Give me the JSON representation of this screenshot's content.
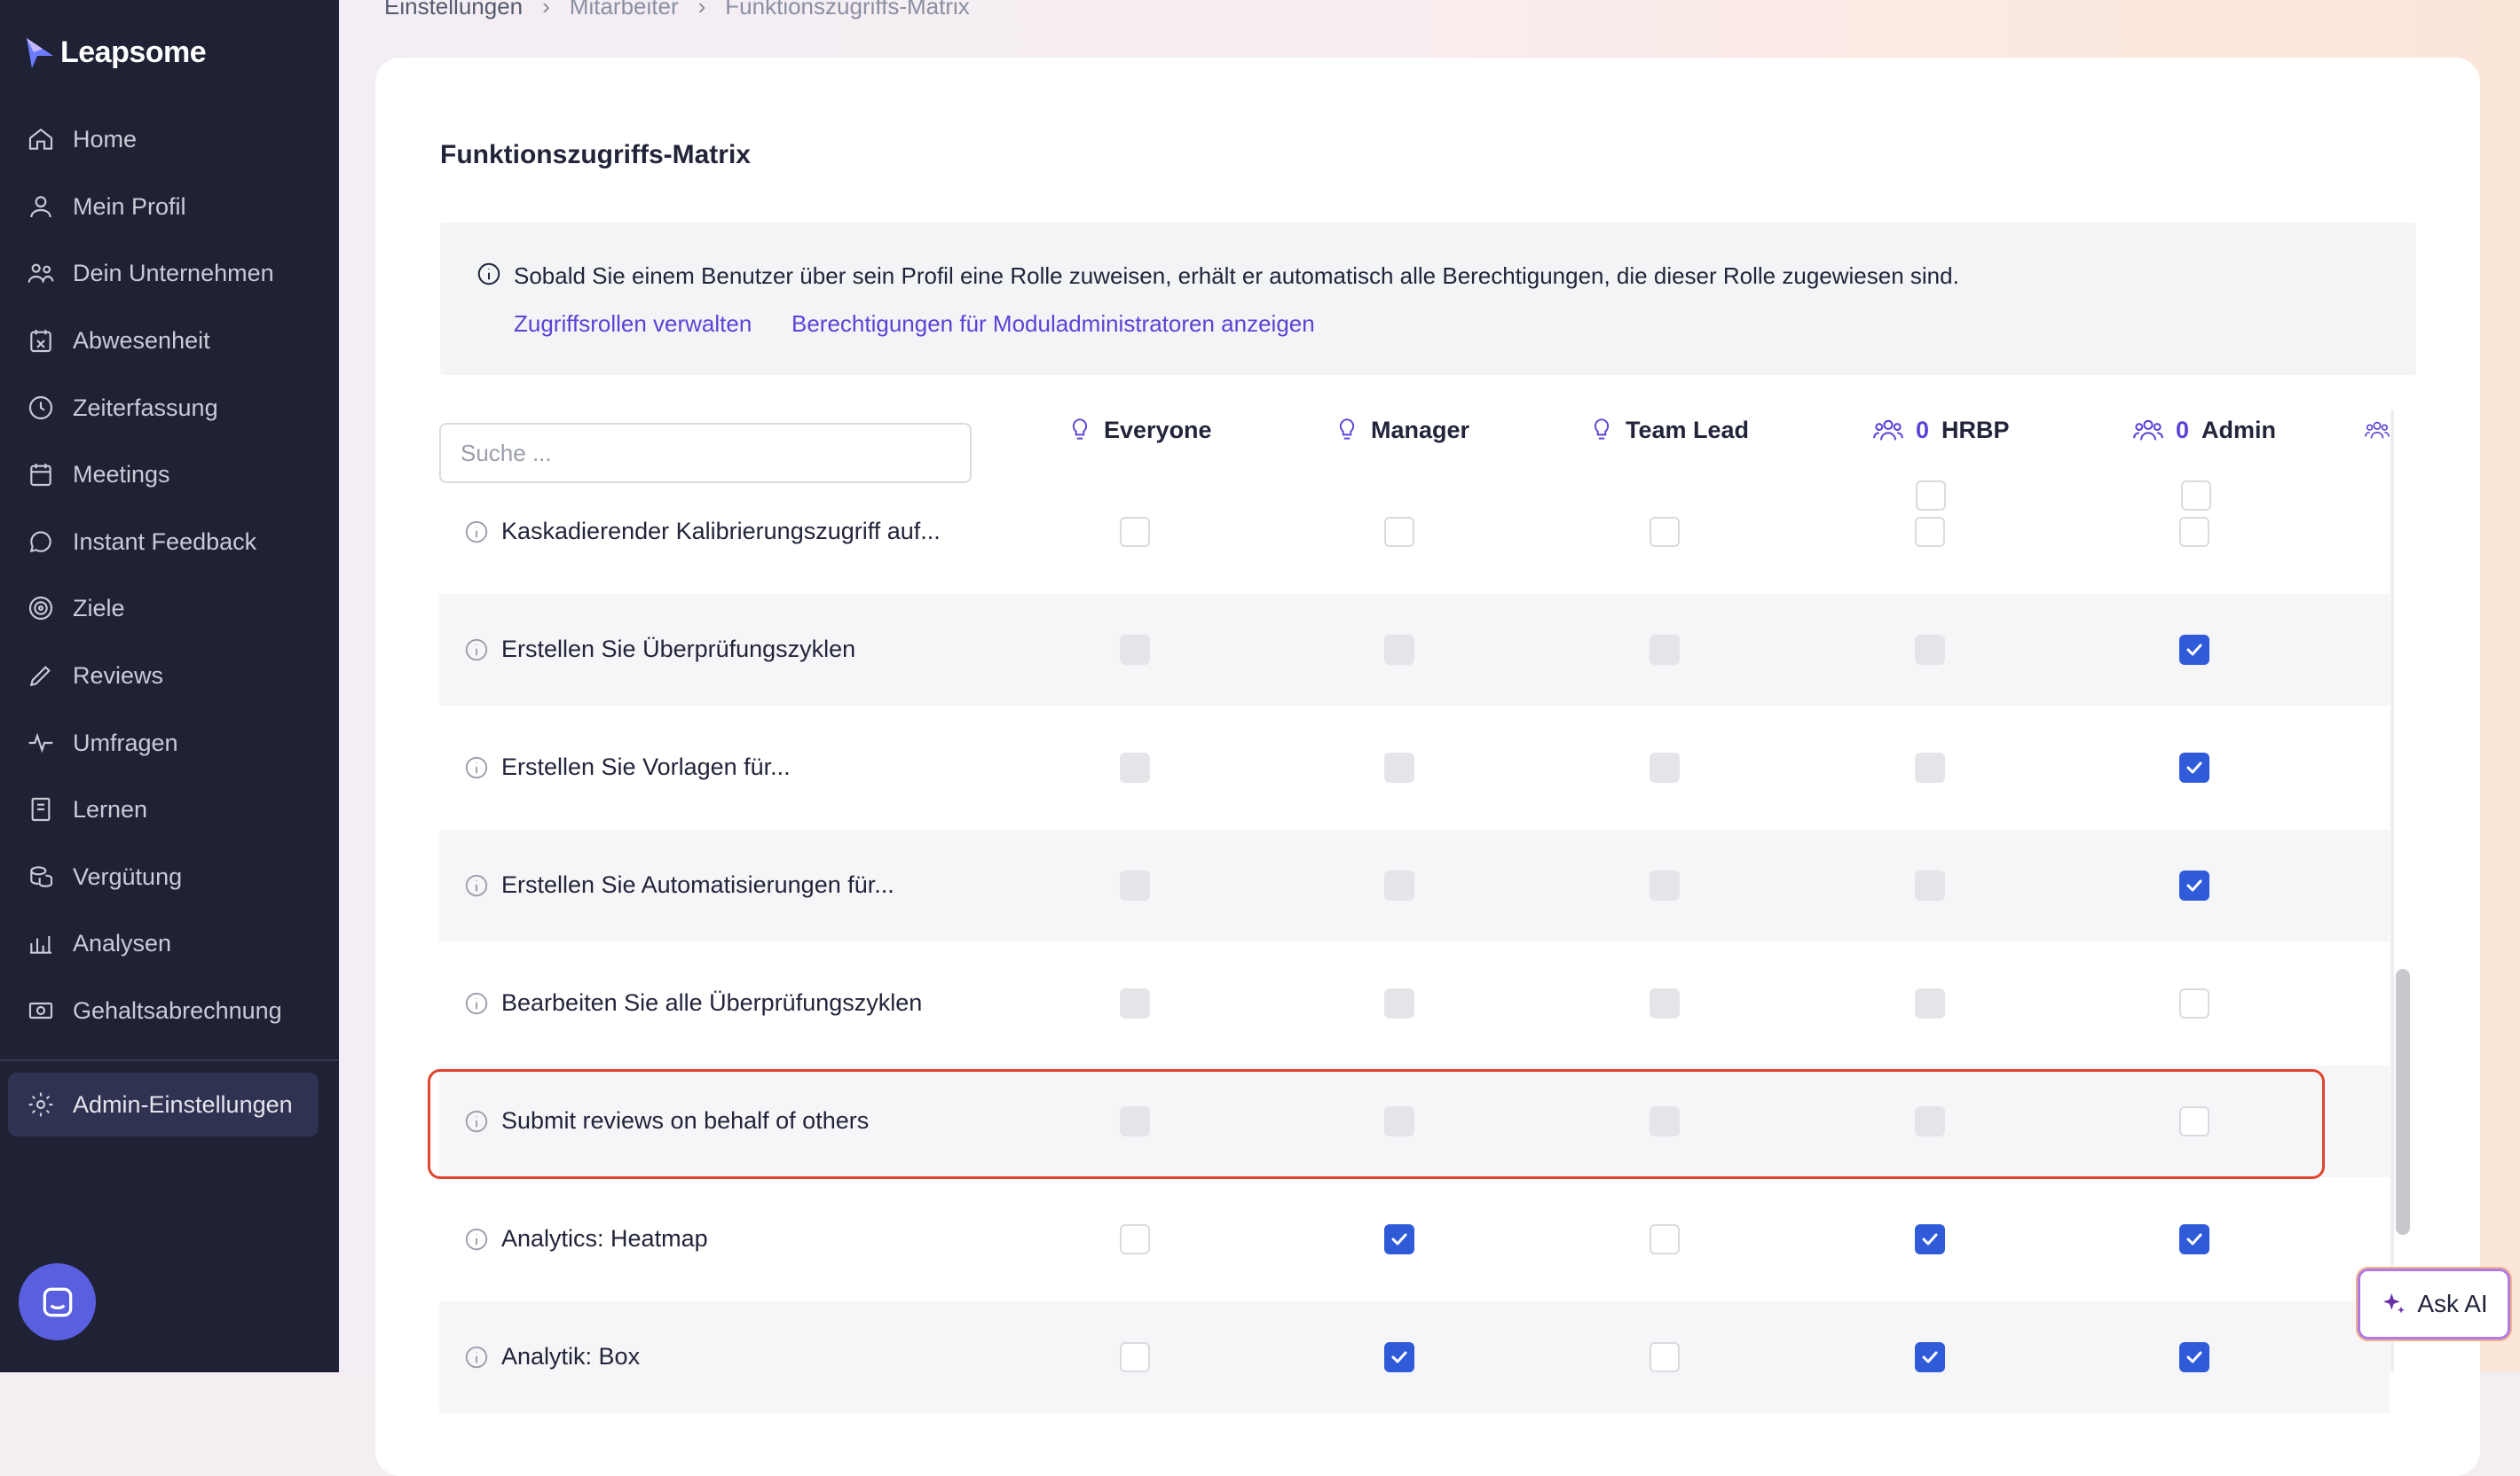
{
  "app": {
    "brand": "Leapsome"
  },
  "sidebar": {
    "items": [
      {
        "label": "Home",
        "icon": "home-icon"
      },
      {
        "label": "Mein Profil",
        "icon": "user-icon"
      },
      {
        "label": "Dein Unternehmen",
        "icon": "users-icon"
      },
      {
        "label": "Abwesenheit",
        "icon": "calendar-x-icon"
      },
      {
        "label": "Zeiterfassung",
        "icon": "clock-icon"
      },
      {
        "label": "Meetings",
        "icon": "calendar-icon"
      },
      {
        "label": "Instant Feedback",
        "icon": "chat-icon"
      },
      {
        "label": "Ziele",
        "icon": "target-icon"
      },
      {
        "label": "Reviews",
        "icon": "pencil-icon"
      },
      {
        "label": "Umfragen",
        "icon": "pulse-icon"
      },
      {
        "label": "Lernen",
        "icon": "book-icon"
      },
      {
        "label": "Vergütung",
        "icon": "coins-icon"
      },
      {
        "label": "Analysen",
        "icon": "bar-chart-icon"
      },
      {
        "label": "Gehaltsabrechnung",
        "icon": "money-icon"
      }
    ],
    "active_item": {
      "label": "Admin-Einstellungen",
      "icon": "gear-icon"
    }
  },
  "breadcrumb": [
    "Einstellungen",
    "Mitarbeiter",
    "Funktionszugriffs-Matrix"
  ],
  "page": {
    "title": "Funktionszugriffs-Matrix",
    "info_text": "Sobald Sie einem Benutzer über sein Profil eine Rolle zuweisen, erhält er automatisch alle Berechtigungen, die dieser Rolle zugewiesen sind.",
    "links": [
      "Zugriffsrollen verwalten",
      "Berechtigungen für Moduladministratoren anzeigen"
    ]
  },
  "search": {
    "placeholder": "Suche ..."
  },
  "columns": [
    {
      "label": "Everyone",
      "icon": "lightbulb-icon",
      "count": ""
    },
    {
      "label": "Manager",
      "icon": "lightbulb-icon",
      "count": ""
    },
    {
      "label": "Team Lead",
      "icon": "lightbulb-icon",
      "count": ""
    },
    {
      "label": "HRBP",
      "icon": "users-group-icon",
      "count": "0"
    },
    {
      "label": "Admin",
      "icon": "users-group-icon",
      "count": "0"
    }
  ],
  "rows": [
    {
      "label": "Kaskadierender Kalibrierungszugriff auf...",
      "states": [
        "off",
        "off",
        "off",
        "off",
        "off"
      ]
    },
    {
      "label": "Erstellen Sie Überprüfungszyklen",
      "states": [
        "dis",
        "dis",
        "dis",
        "dis",
        "on"
      ]
    },
    {
      "label": "Erstellen Sie Vorlagen für...",
      "states": [
        "dis",
        "dis",
        "dis",
        "dis",
        "on"
      ]
    },
    {
      "label": "Erstellen Sie Automatisierungen für...",
      "states": [
        "dis",
        "dis",
        "dis",
        "dis",
        "on"
      ]
    },
    {
      "label": "Bearbeiten Sie alle Überprüfungszyklen",
      "states": [
        "dis",
        "dis",
        "dis",
        "dis",
        "off"
      ]
    },
    {
      "label": "Submit reviews on behalf of others",
      "states": [
        "dis",
        "dis",
        "dis",
        "dis",
        "off"
      ]
    },
    {
      "label": "Analytics: Heatmap",
      "states": [
        "off",
        "on",
        "off",
        "on",
        "on"
      ]
    },
    {
      "label": "Analytik: Box",
      "states": [
        "off",
        "on",
        "off",
        "on",
        "on"
      ]
    }
  ],
  "ask_ai": {
    "label": "Ask AI"
  },
  "colors": {
    "accent": "#2f5bd9",
    "link": "#5b43d6",
    "sidebar": "#1f2235",
    "highlight": "#e0442f"
  }
}
